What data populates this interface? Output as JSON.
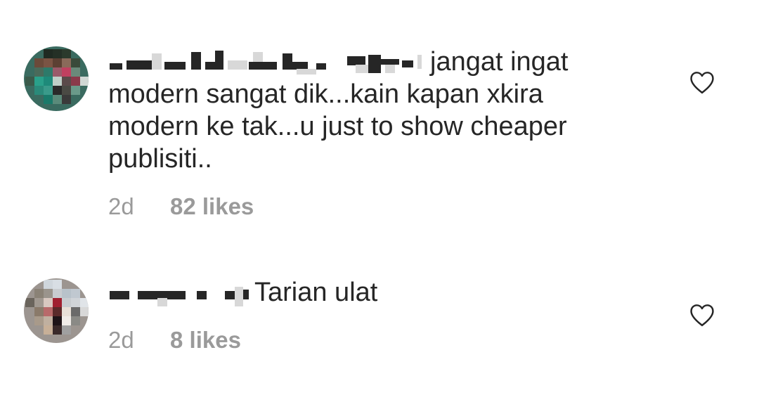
{
  "comments": [
    {
      "text_lines": [
        "jangat ingat",
        "modern sangat dik...kain kapan xkira",
        "modern ke tak...u just to show cheaper",
        "publisiti.."
      ],
      "time": "2d",
      "likes": "82 likes",
      "like_icon": "heart-outline-icon"
    },
    {
      "text_lines": [
        "Tarian ulat"
      ],
      "time": "2d",
      "likes": "8 likes",
      "like_icon": "heart-outline-icon"
    }
  ],
  "colors": {
    "text": "#262626",
    "meta": "#9a9a9a",
    "heart_stroke": "#262626",
    "background": "#ffffff"
  }
}
